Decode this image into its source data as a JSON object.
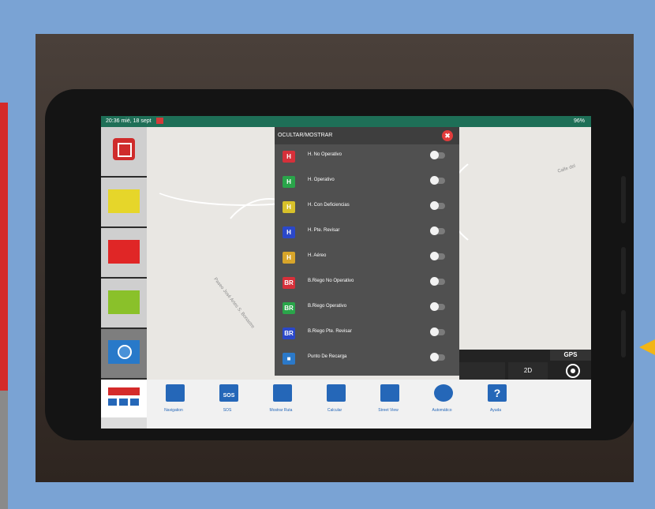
{
  "status_bar": {
    "left_text": "20:36  mié, 18 sept",
    "right_text": "96%"
  },
  "map": {
    "road_label_main": "Paseo José Artes S. Bonastre",
    "road_label_right": "Calle del"
  },
  "panel": {
    "title": "OCULTAR/MOSTRAR",
    "close_label": "✖",
    "rows": [
      {
        "badge": "H",
        "badge_color": "#d6303a",
        "label": "H. No Operativo"
      },
      {
        "badge": "H",
        "badge_color": "#2aa54a",
        "label": "H. Operativo"
      },
      {
        "badge": "H",
        "badge_color": "#d8c12a",
        "label": "H. Con Deficiencias"
      },
      {
        "badge": "H",
        "badge_color": "#2b48c9",
        "label": "H. Pte. Revisar"
      },
      {
        "badge": "H",
        "badge_color": "#d8a52a",
        "label": "H. Aéreo"
      },
      {
        "badge": "BR",
        "badge_color": "#d6303a",
        "label": "B.Riego No Operativo"
      },
      {
        "badge": "BR",
        "badge_color": "#2aa54a",
        "label": "B.Riego Operativo"
      },
      {
        "badge": "BR",
        "badge_color": "#2b48c9",
        "label": "B.Riego Pte. Revisar"
      },
      {
        "badge": "■",
        "badge_color": "#2b79c9",
        "label": "Punto De Recarga"
      }
    ]
  },
  "controls": {
    "gps_label": "GPS",
    "view_2d_label": "2D"
  },
  "tabs": [
    {
      "label": "Navigation",
      "icon": "image-icon"
    },
    {
      "label": "SOS",
      "icon": "sos-icon",
      "glyph": "SOS"
    },
    {
      "label": "Mostrar Ruta",
      "icon": "route-icon"
    },
    {
      "label": "Calcular",
      "icon": "calculate-icon"
    },
    {
      "label": "Street View",
      "icon": "street-view-icon"
    },
    {
      "label": "Automático",
      "icon": "automatic-icon"
    },
    {
      "label": "Ayuda",
      "icon": "help-icon",
      "glyph": "?"
    }
  ],
  "sidebar": {
    "colors": {
      "yellow": "#e6d62a",
      "red": "#e02626",
      "green": "#8ac12a",
      "blue": "#2879c9"
    }
  }
}
